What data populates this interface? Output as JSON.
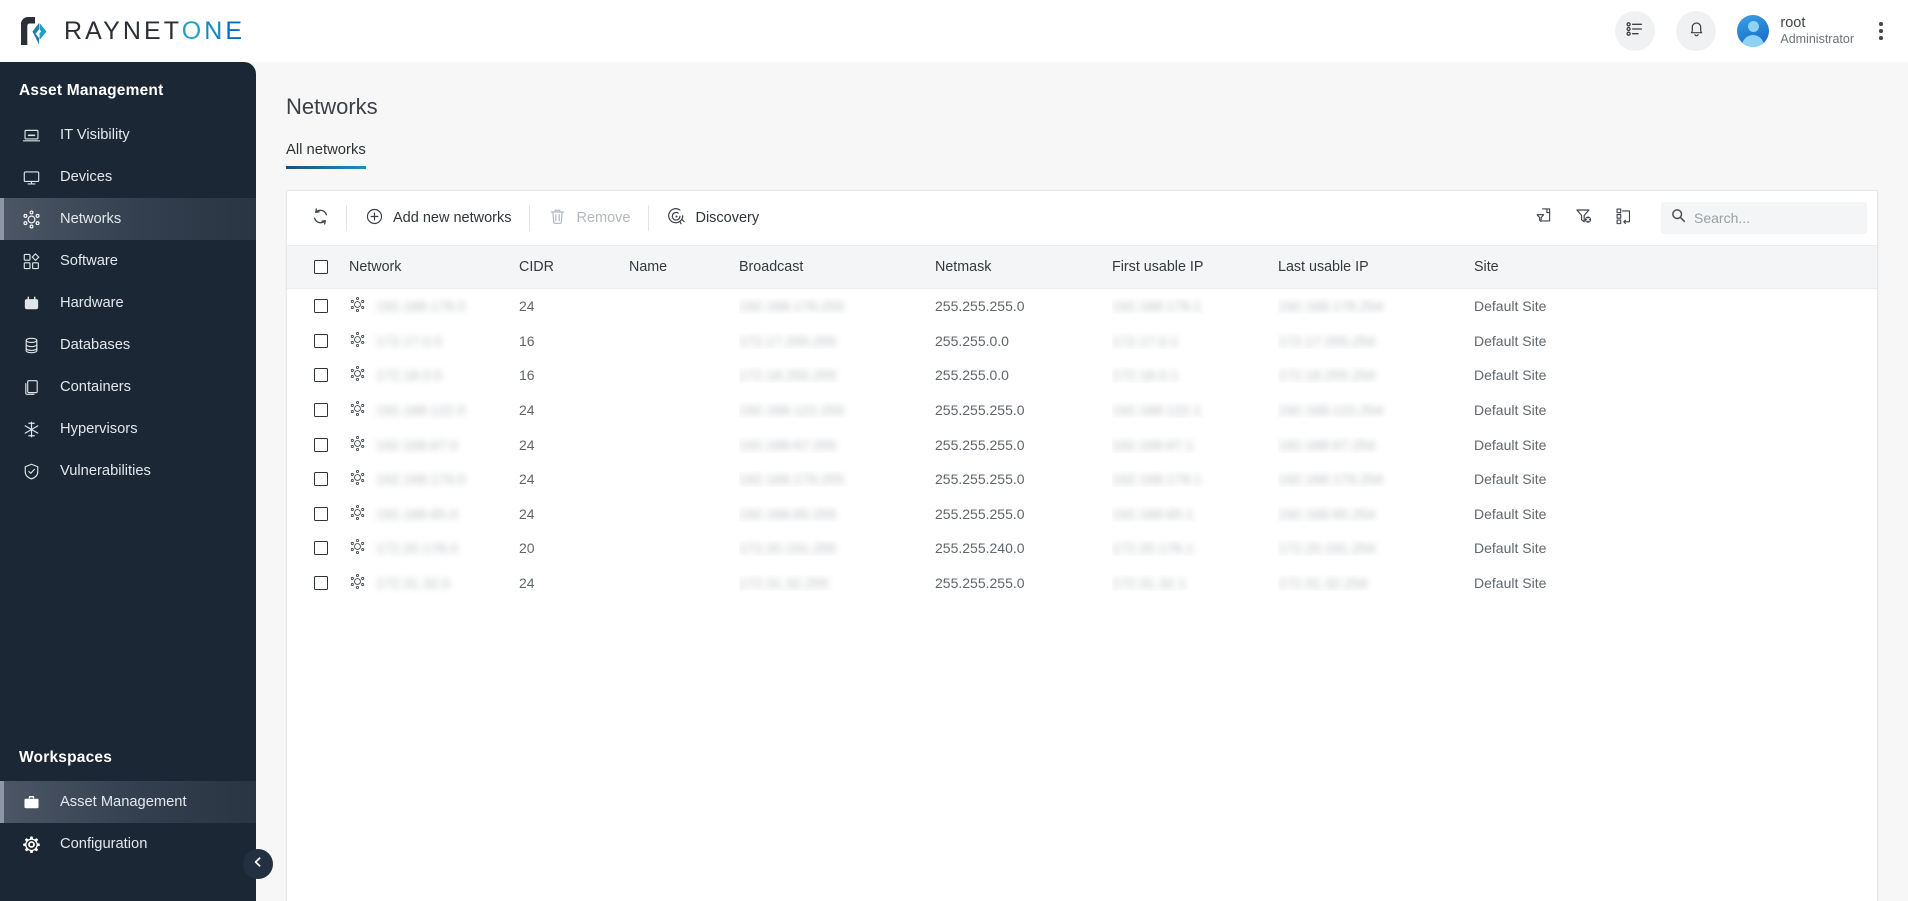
{
  "brand": {
    "name_part1": "RAYNET",
    "name_o": "O",
    "name_n": "N",
    "name_e": "E",
    "logo_dark": "#2b3036",
    "logo_teal": "#23a1c4",
    "logo_blue": "#0a6dbd"
  },
  "topbar": {
    "tasks_icon": "task-list-icon",
    "notifications_icon": "bell-icon",
    "user_name": "root",
    "user_role": "Administrator",
    "more_icon": "vertical-dots-icon"
  },
  "sidebar": {
    "section_title": "Asset Management",
    "items": [
      {
        "label": "IT Visibility",
        "icon": "laptop-icon",
        "active": false
      },
      {
        "label": "Devices",
        "icon": "monitor-icon",
        "active": false
      },
      {
        "label": "Networks",
        "icon": "network-hub-icon",
        "active": true
      },
      {
        "label": "Software",
        "icon": "app-blocks-icon",
        "active": false
      },
      {
        "label": "Hardware",
        "icon": "hardware-chip-icon",
        "active": false
      },
      {
        "label": "Databases",
        "icon": "database-icon",
        "active": false
      },
      {
        "label": "Containers",
        "icon": "containers-icon",
        "active": false
      },
      {
        "label": "Hypervisors",
        "icon": "hypervisor-icon",
        "active": false
      },
      {
        "label": "Vulnerabilities",
        "icon": "shield-icon",
        "active": false
      }
    ],
    "workspaces_title": "Workspaces",
    "workspaces": [
      {
        "label": "Asset Management",
        "icon": "briefcase-icon",
        "active": true
      },
      {
        "label": "Configuration",
        "icon": "gear-icon",
        "active": false
      }
    ],
    "collapse_icon": "chevron-left-icon",
    "active_bg": "#3c4856"
  },
  "page": {
    "title": "Networks",
    "tabs": [
      {
        "label": "All networks",
        "active": true
      }
    ],
    "tab_underline_color": "#1b8fc4"
  },
  "toolbar": {
    "refresh_label": "",
    "refresh_icon": "refresh-icon",
    "add_label": "Add new networks",
    "add_icon": "plus-circle-icon",
    "remove_label": "Remove",
    "remove_icon": "trash-icon",
    "remove_disabled": true,
    "discovery_label": "Discovery",
    "discovery_icon": "radar-discovery-icon",
    "saved_filter_icon": "filter-document-icon",
    "clear_filter_icon": "filter-clear-icon",
    "columns_icon": "column-settings-icon",
    "search_icon": "search-icon",
    "search_value": "",
    "search_placeholder": "Search..."
  },
  "table": {
    "select_all_checked": false,
    "columns": [
      "Network",
      "CIDR",
      "Name",
      "Broadcast",
      "Netmask",
      "First usable IP",
      "Last usable IP",
      "Site"
    ],
    "rows": [
      {
        "network": "192.168.178.0",
        "cidr": "24",
        "name": "",
        "broadcast": "192.168.178.255",
        "netmask": "255.255.255.0",
        "first_ip": "192.168.178.1",
        "last_ip": "192.168.178.254",
        "site": "Default Site",
        "redacted": true
      },
      {
        "network": "172.17.0.0",
        "cidr": "16",
        "name": "",
        "broadcast": "172.17.255.255",
        "netmask": "255.255.0.0",
        "first_ip": "172.17.0.1",
        "last_ip": "172.17.255.254",
        "site": "Default Site",
        "redacted": true
      },
      {
        "network": "172.18.0.0",
        "cidr": "16",
        "name": "",
        "broadcast": "172.18.255.255",
        "netmask": "255.255.0.0",
        "first_ip": "172.18.0.1",
        "last_ip": "172.18.255.254",
        "site": "Default Site",
        "redacted": true
      },
      {
        "network": "192.168.122.0",
        "cidr": "24",
        "name": "",
        "broadcast": "192.168.122.255",
        "netmask": "255.255.255.0",
        "first_ip": "192.168.122.1",
        "last_ip": "192.168.122.254",
        "site": "Default Site",
        "redacted": true
      },
      {
        "network": "192.168.67.0",
        "cidr": "24",
        "name": "",
        "broadcast": "192.168.67.255",
        "netmask": "255.255.255.0",
        "first_ip": "192.168.67.1",
        "last_ip": "192.168.67.254",
        "site": "Default Site",
        "redacted": true
      },
      {
        "network": "192.168.179.0",
        "cidr": "24",
        "name": "",
        "broadcast": "192.168.179.255",
        "netmask": "255.255.255.0",
        "first_ip": "192.168.179.1",
        "last_ip": "192.168.179.254",
        "site": "Default Site",
        "redacted": true
      },
      {
        "network": "192.168.65.0",
        "cidr": "24",
        "name": "",
        "broadcast": "192.168.65.255",
        "netmask": "255.255.255.0",
        "first_ip": "192.168.65.1",
        "last_ip": "192.168.65.254",
        "site": "Default Site",
        "redacted": true
      },
      {
        "network": "172.20.176.0",
        "cidr": "20",
        "name": "",
        "broadcast": "172.20.191.255",
        "netmask": "255.255.240.0",
        "first_ip": "172.20.176.1",
        "last_ip": "172.20.191.254",
        "site": "Default Site",
        "redacted": true
      },
      {
        "network": "172.31.32.0",
        "cidr": "24",
        "name": "",
        "broadcast": "172.31.32.255",
        "netmask": "255.255.255.0",
        "first_ip": "172.31.32.1",
        "last_ip": "172.31.32.254",
        "site": "Default Site",
        "redacted": true
      }
    ]
  }
}
